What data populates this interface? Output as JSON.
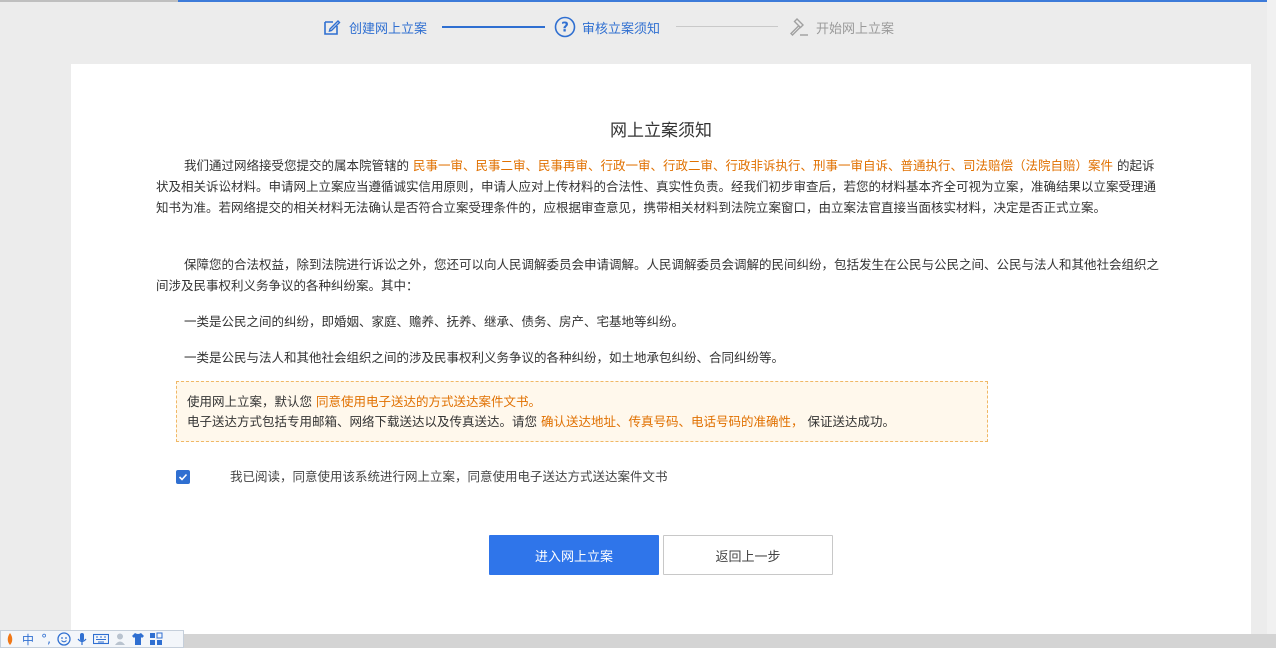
{
  "steps": [
    {
      "label": "创建网上立案",
      "state": "active",
      "icon": "edit-icon"
    },
    {
      "label": "审核立案须知",
      "state": "active",
      "icon": "question-circle-icon"
    },
    {
      "label": "开始网上立案",
      "state": "disabled",
      "icon": "gavel-icon"
    }
  ],
  "title": "网上立案须知",
  "para1": {
    "prefix": "我们通过网络接受您提交的属本院管辖的",
    "highlight": "民事一审、民事二审、民事再审、行政一审、行政二审、行政非诉执行、刑事一审自诉、普通执行、司法赔偿（法院自赔）案件",
    "suffix": "的起诉状及相关诉讼材料。申请网上立案应当遵循诚实信用原则，申请人应对上传材料的合法性、真实性负责。经我们初步审查后，若您的材料基本齐全可视为立案，准确结果以立案受理通知书为准。若网络提交的相关材料无法确认是否符合立案受理条件的，应根据审查意见，携带相关材料到法院立案窗口，由立案法官直接当面核实材料，决定是否正式立案。"
  },
  "para2": "保障您的合法权益，除到法院进行诉讼之外，您还可以向人民调解委员会申请调解。人民调解委员会调解的民间纠纷，包括发生在公民与公民之间、公民与法人和其他社会组织之间涉及民事权利义务争议的各种纠纷案。其中：",
  "para3": "一类是公民之间的纠纷，即婚姻、家庭、赡养、抚养、继承、债务、房产、宅基地等纠纷。",
  "para4": "一类是公民与法人和其他社会组织之间的涉及民事权利义务争议的各种纠纷，如土地承包纠纷、合同纠纷等。",
  "notice": {
    "line1_prefix": "使用网上立案，默认您",
    "line1_highlight": "同意使用电子送达的方式送达案件文书。",
    "line2_prefix": "电子送达方式包括专用邮箱、网络下载送达以及传真送达。请您",
    "line2_highlight": "确认送达地址、传真号码、电话号码的准确性，",
    "line2_suffix": "保证送达成功。"
  },
  "agree": {
    "checked": true,
    "label": "我已阅读，同意使用该系统进行网上立案，同意使用电子送达方式送达案件文书"
  },
  "buttons": {
    "primary": "进入网上立案",
    "secondary": "返回上一步"
  },
  "ime": {
    "mode": "中",
    "punct": "°,"
  },
  "colors": {
    "accent": "#2f6fd1",
    "highlight": "#e07000",
    "notice_bg": "#fff8ec",
    "notice_border": "#f0b866"
  }
}
